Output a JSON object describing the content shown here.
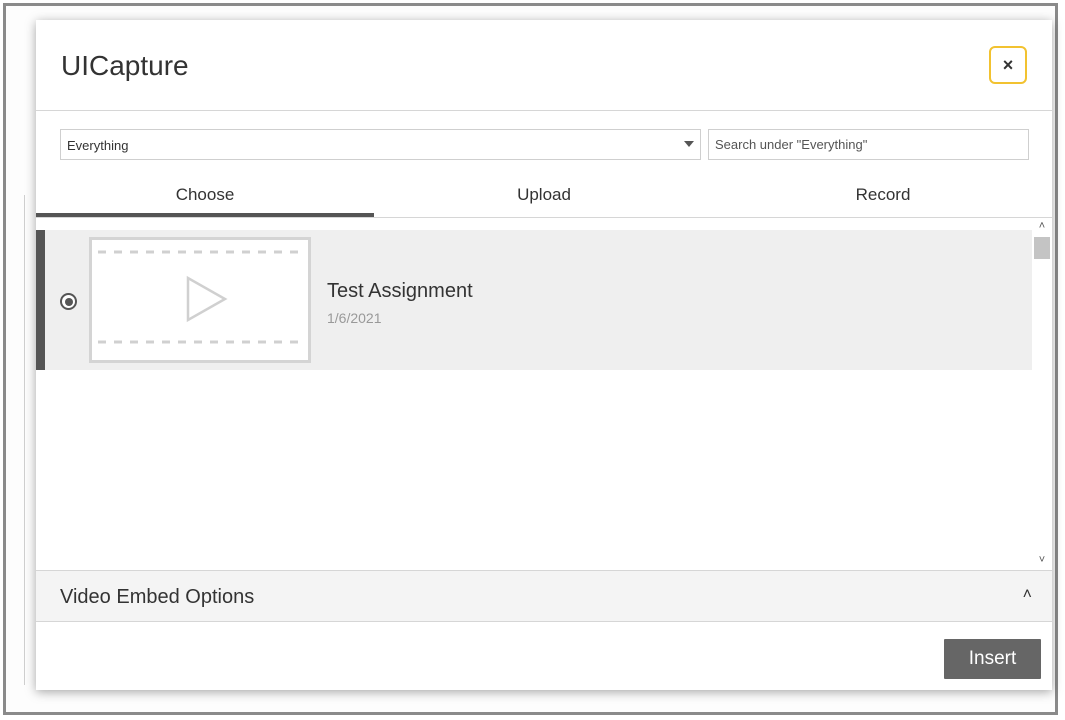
{
  "dialog": {
    "title": "UICapture",
    "close_label": "×"
  },
  "filter": {
    "selected": "Everything",
    "search_placeholder": "Search under \"Everything\""
  },
  "tabs": [
    {
      "label": "Choose",
      "active": true
    },
    {
      "label": "Upload",
      "active": false
    },
    {
      "label": "Record",
      "active": false
    }
  ],
  "items": [
    {
      "title": "Test Assignment",
      "date": "1/6/2021",
      "selected": true,
      "icon": "video-play-icon"
    }
  ],
  "scrollbar": {
    "up": "˄",
    "down": "˅"
  },
  "embed_options": {
    "label": "Video Embed Options",
    "chevron": "˄"
  },
  "footer": {
    "insert_label": "Insert"
  },
  "colors": {
    "accent": "#555555",
    "close_border": "#f2c230",
    "insert_bg": "#666666",
    "selected_row_bg": "#efefef"
  }
}
